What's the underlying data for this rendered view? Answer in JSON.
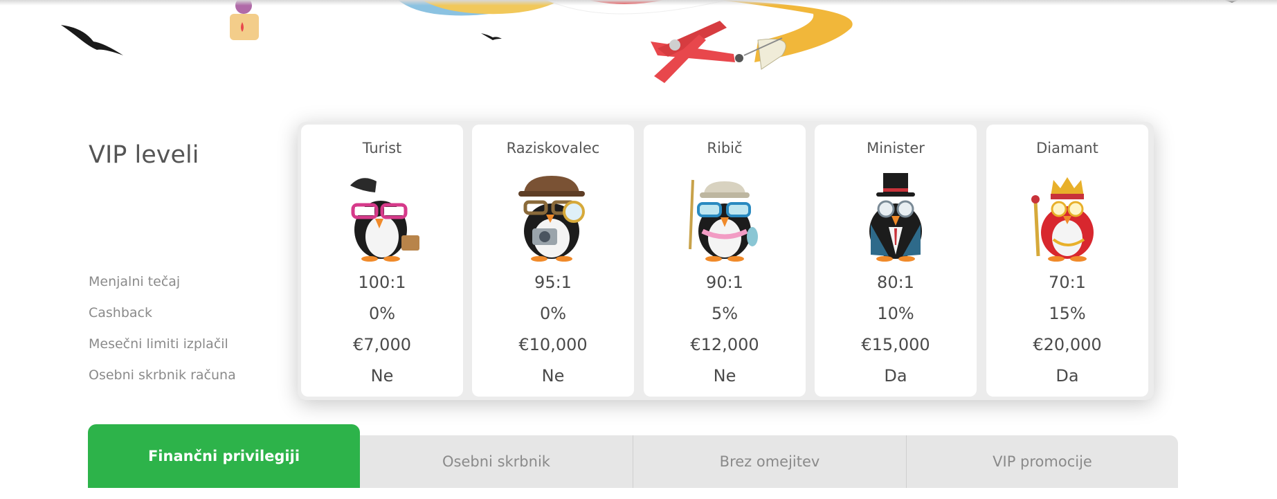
{
  "section": {
    "title": "VIP leveli",
    "row_labels": [
      "Menjalni tečaj",
      "Cashback",
      "Mesečni limiti izplačil",
      "Osebni skrbnik računa"
    ]
  },
  "levels": [
    {
      "name": "Turist",
      "exchange": "100:1",
      "cashback": "0%",
      "limit": "€7,000",
      "manager": "Ne",
      "icon": "tourist-penguin-icon"
    },
    {
      "name": "Raziskovalec",
      "exchange": "95:1",
      "cashback": "0%",
      "limit": "€10,000",
      "manager": "Ne",
      "icon": "explorer-penguin-icon"
    },
    {
      "name": "Ribič",
      "exchange": "90:1",
      "cashback": "5%",
      "limit": "€12,000",
      "manager": "Ne",
      "icon": "fisherman-penguin-icon"
    },
    {
      "name": "Minister",
      "exchange": "80:1",
      "cashback": "10%",
      "limit": "€15,000",
      "manager": "Da",
      "icon": "minister-penguin-icon"
    },
    {
      "name": "Diamant",
      "exchange": "70:1",
      "cashback": "15%",
      "limit": "€20,000",
      "manager": "Da",
      "icon": "king-penguin-icon"
    }
  ],
  "tabs": [
    {
      "label": "Finančni privilegiji",
      "active": true
    },
    {
      "label": "Osebni skrbnik",
      "active": false
    },
    {
      "label": "Brez omejitev",
      "active": false
    },
    {
      "label": "VIP promocije",
      "active": false
    }
  ],
  "colors": {
    "accent": "#2db34a",
    "tab_bg": "#e6e6e6",
    "plane_red": "#e8474c",
    "banner_yellow": "#f1b73a"
  }
}
